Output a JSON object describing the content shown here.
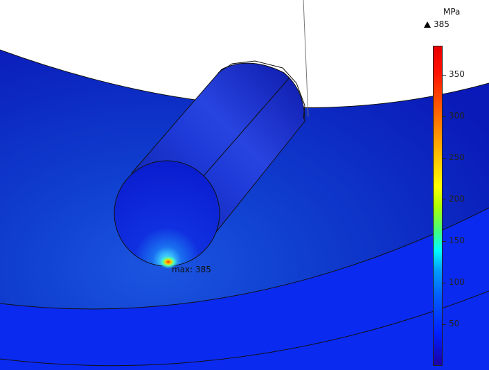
{
  "legend": {
    "unit": "MPa",
    "max_value_label": "385",
    "ticks": [
      "350",
      "300",
      "250",
      "200",
      "150",
      "100",
      "50"
    ],
    "tick_values": [
      350,
      300,
      250,
      200,
      150,
      100,
      50
    ],
    "range": [
      0,
      385
    ]
  },
  "annotation": {
    "max_label": "max: 385"
  },
  "colors": {
    "background": "#ffffff",
    "low_stress": "#0a17c8",
    "high_stress": "#ff2000"
  }
}
